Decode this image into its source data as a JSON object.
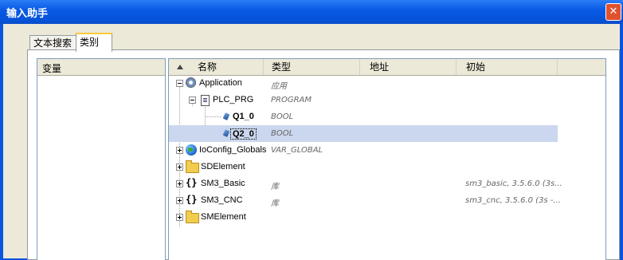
{
  "window": {
    "title": "输入助手"
  },
  "tabs": [
    "文本搜索",
    "类别"
  ],
  "left_panel": {
    "header": "变量"
  },
  "columns": [
    "名称",
    "类型",
    "地址",
    "初始"
  ],
  "rows": [
    {
      "name": "Application",
      "type": "应用",
      "init": "",
      "icon": "application-icon",
      "selected": false
    },
    {
      "name": "PLC_PRG",
      "type": "PROGRAM",
      "init": "",
      "icon": "program-icon",
      "selected": false
    },
    {
      "name": "Q1_0",
      "type": "BOOL",
      "init": "",
      "icon": "variable-icon",
      "selected": false
    },
    {
      "name": "Q2_0",
      "type": "BOOL",
      "init": "",
      "icon": "variable-icon",
      "selected": true
    },
    {
      "name": "IoConfig_Globals",
      "type": "VAR_GLOBAL",
      "init": "",
      "icon": "globe-icon",
      "selected": false
    },
    {
      "name": "SDElement",
      "type": "",
      "init": "",
      "icon": "folder-icon",
      "selected": false
    },
    {
      "name": "SM3_Basic",
      "type": "库",
      "init": "sm3_basic, 3.5.6.0 (3s...",
      "icon": "library-icon",
      "selected": false
    },
    {
      "name": "SM3_CNC",
      "type": "库",
      "init": "sm3_cnc, 3.5.6.0 (3s -...",
      "icon": "library-icon",
      "selected": false
    },
    {
      "name": "SMElement",
      "type": "",
      "init": "",
      "icon": "folder-icon",
      "selected": false
    }
  ],
  "colors": {
    "titlebar": "#0a5ae6",
    "selection": "#cbd7ee",
    "close": "#e0512e"
  }
}
